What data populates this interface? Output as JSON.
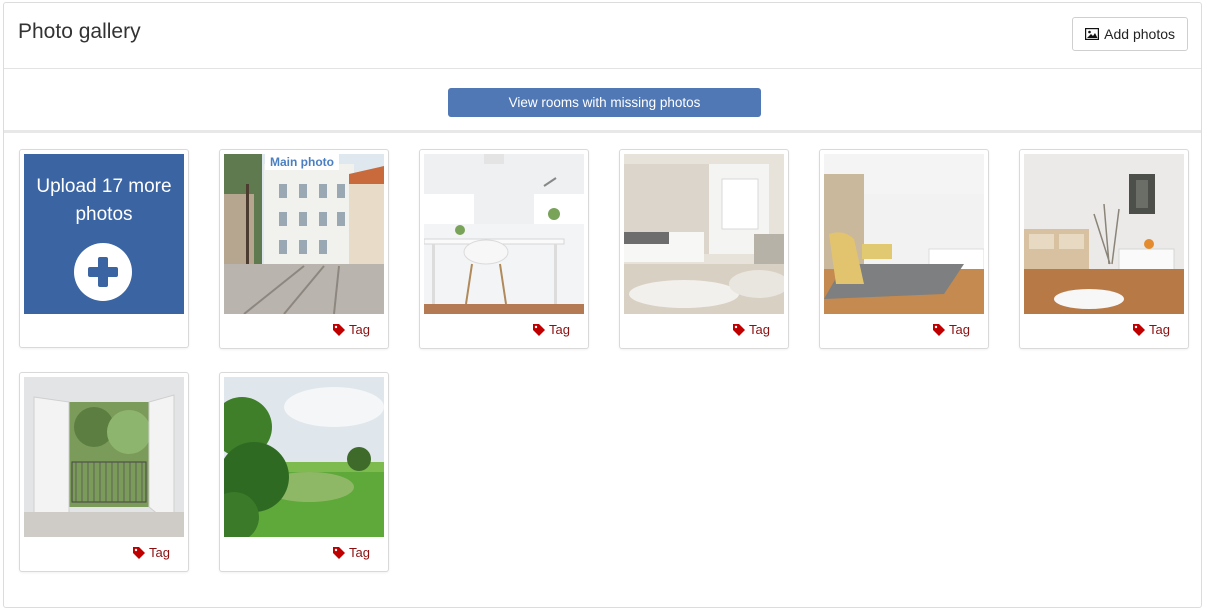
{
  "header": {
    "title": "Photo gallery",
    "add_photos_label": "Add photos"
  },
  "toolbar": {
    "missing_photos_label": "View rooms with missing photos"
  },
  "upload": {
    "label": "Upload 17 more photos"
  },
  "photos": [
    {
      "badge": "Main photo",
      "tag_label": "Tag",
      "subject": "street-scene"
    },
    {
      "tag_label": "Tag",
      "subject": "white-desk-room"
    },
    {
      "tag_label": "Tag",
      "subject": "bedroom"
    },
    {
      "tag_label": "Tag",
      "subject": "studio-room"
    },
    {
      "tag_label": "Tag",
      "subject": "living-room-shelves"
    },
    {
      "tag_label": "Tag",
      "subject": "window-garden-view"
    },
    {
      "tag_label": "Tag",
      "subject": "green-landscape"
    }
  ],
  "colors": {
    "primary_button": "#5078b4",
    "upload_tile": "#3b64a3",
    "tag": "#8b1010",
    "badge_text": "#4a7fc1"
  }
}
